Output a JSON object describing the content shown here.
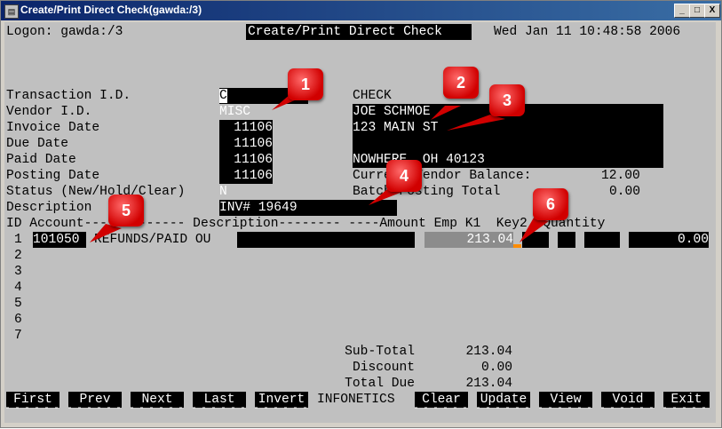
{
  "window": {
    "title": "Create/Print Direct Check(gawda:/3)",
    "buttons": [
      "_",
      "□",
      "X"
    ]
  },
  "header": {
    "logon": "Logon: gawda:/3",
    "screen_title": "Create/Print Direct Check",
    "datetime": "Wed Jan 11 10:48:58 2006"
  },
  "form": {
    "labels": {
      "transaction_id": "Transaction I.D.",
      "vendor_id": "Vendor I.D.",
      "invoice_date": "Invoice Date",
      "due_date": "Due Date",
      "paid_date": "Paid Date",
      "posting_date": "Posting Date",
      "status": "Status (New/Hold/Clear)",
      "description": "Description"
    },
    "values": {
      "transaction_id": "C",
      "vendor_id": "MISC",
      "invoice_date": "11106",
      "due_date": "11106",
      "paid_date": "11106",
      "posting_date": "11106",
      "status": "N",
      "description": "INV# 19649"
    },
    "check": {
      "type": "CHECK",
      "payee": "JOE SCHMOE",
      "address1": "123 MAIN ST",
      "city_state_zip": "NOWHERE  OH 40123",
      "vendor_balance_label": "Current Vendor Balance:",
      "vendor_balance": "12.00",
      "posting_total_label": "Batch Posting Total",
      "posting_total": "0.00"
    }
  },
  "table": {
    "header": "ID Account------------- Description-------- ----Amount Emp K1  Key2 -Quantity",
    "rows": [
      {
        "id": "1",
        "account": "101050",
        "account_desc": "REFUNDS/PAID OU",
        "description": "",
        "amount": "213.04",
        "quantity": "0.00"
      },
      {
        "id": "2"
      },
      {
        "id": "3"
      },
      {
        "id": "4"
      },
      {
        "id": "5"
      },
      {
        "id": "6"
      },
      {
        "id": "7"
      }
    ]
  },
  "totals": {
    "subtotal_label": "Sub-Total",
    "subtotal": "213.04",
    "discount_label": "Discount",
    "discount": "0.00",
    "total_due_label": "Total Due",
    "total_due": "213.04"
  },
  "function_keys": {
    "first": "First",
    "prev": "Prev",
    "next": "Next",
    "last": "Last",
    "invert": "Invert",
    "brand": "INFONETICS",
    "clear": "Clear",
    "update": "Update",
    "view": "View",
    "void": "Void",
    "exit": "Exit"
  },
  "callouts": [
    "1",
    "2",
    "3",
    "4",
    "5",
    "6"
  ],
  "colors": {
    "title_bar": "#0a246a",
    "terminal_bg": "#c0c0c0",
    "callout": "#d10000",
    "cursor": "#ff8c00"
  }
}
